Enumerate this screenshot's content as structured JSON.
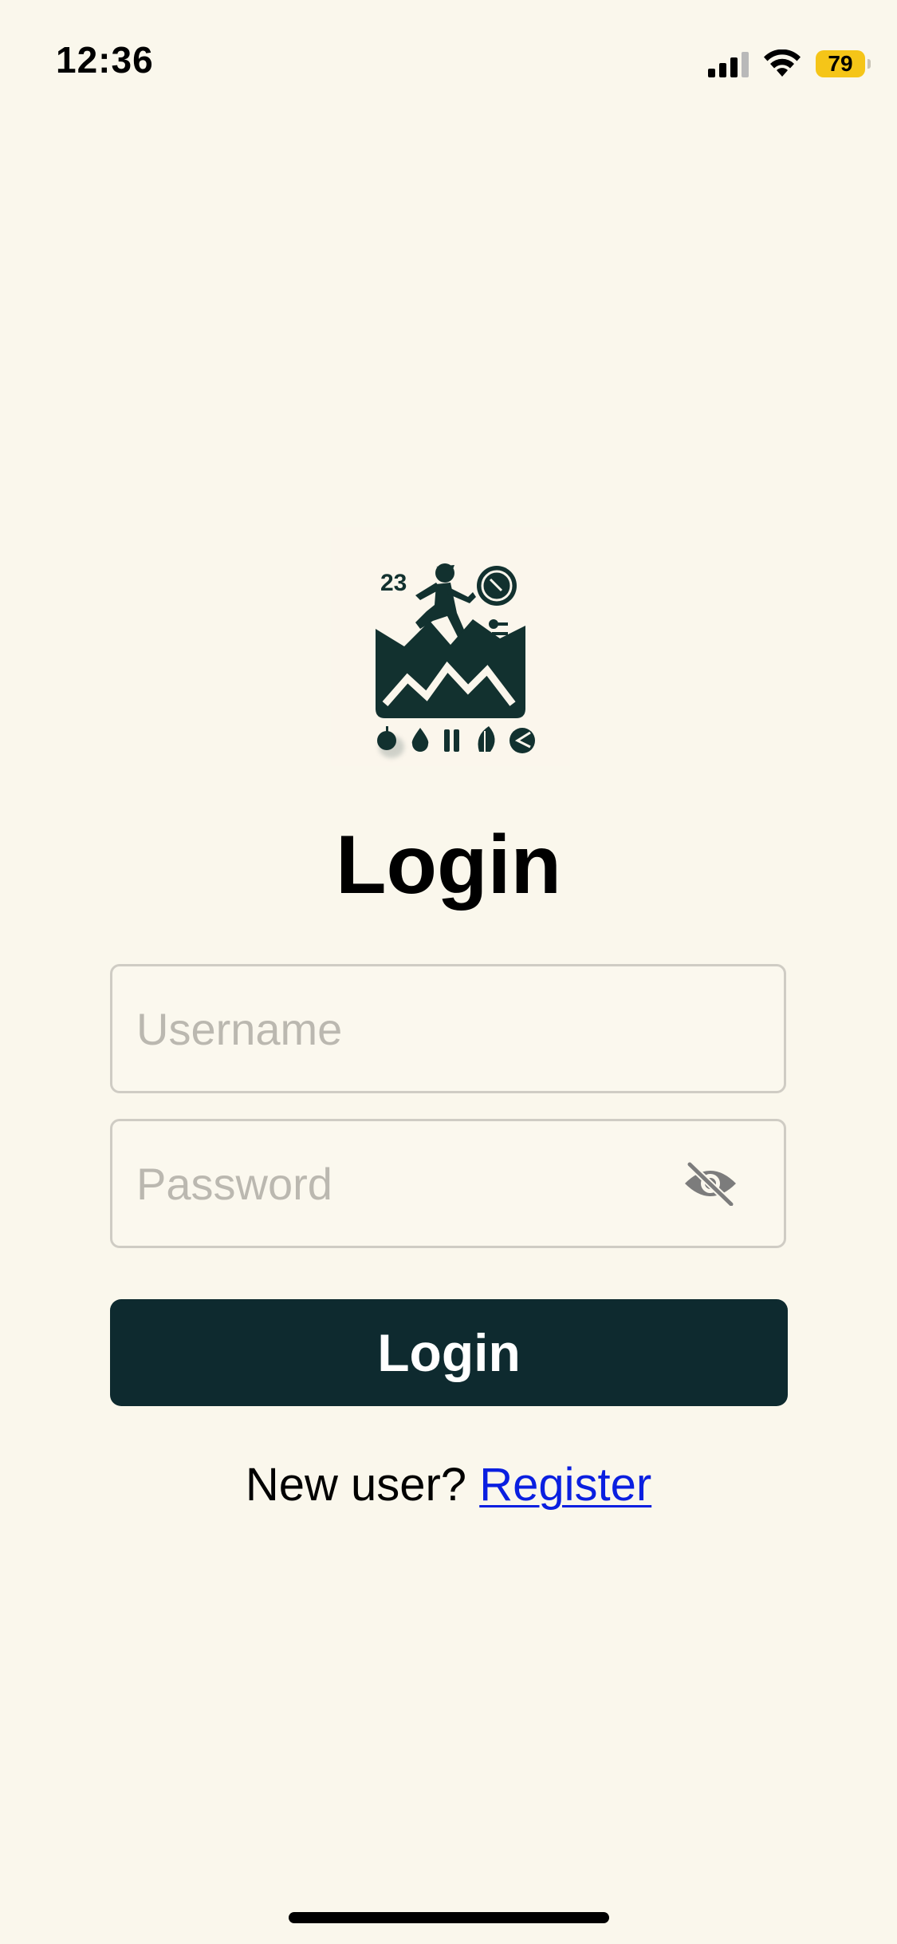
{
  "status_bar": {
    "time": "12:36",
    "battery_level": "79",
    "battery_color": "#F5C518",
    "signal_bars_active": 3,
    "signal_bars_total": 4,
    "icons": [
      "cellular-signal-icon",
      "wifi-icon",
      "battery-icon"
    ]
  },
  "logo": {
    "icon": "fitness-runner-logo",
    "badge_number": "23",
    "symbols": [
      "apple-icon",
      "water-drop-icon",
      "pause-icon",
      "leaf-icon",
      "chart-icon"
    ]
  },
  "login_form": {
    "title": "Login",
    "username_placeholder": "Username",
    "username_value": "",
    "password_placeholder": "Password",
    "password_value": "",
    "password_toggle_icon": "eye-slash-icon",
    "submit_label": "Login",
    "submit_color": "#0E2A2F"
  },
  "register": {
    "prompt": "New user?",
    "link_label": "Register",
    "link_color": "#0A1FE0"
  },
  "theme": {
    "background": "#FAF7EC"
  }
}
